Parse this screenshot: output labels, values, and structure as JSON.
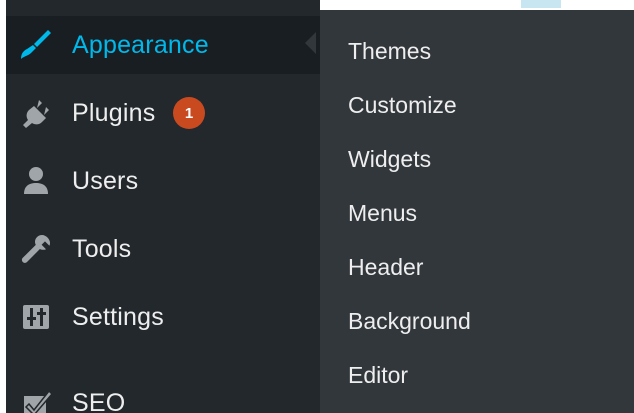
{
  "colors": {
    "menu_bg": "#23282d",
    "menu_current_bg": "#191e23",
    "submenu_bg": "#32373c",
    "text": "#eeeeee",
    "accent": "#00b9eb",
    "icon": "#a0a5aa",
    "badge": "#ca4a1f"
  },
  "menu": {
    "items": [
      {
        "label": "Appearance",
        "icon": "paintbrush-icon",
        "current": true
      },
      {
        "label": "Plugins",
        "icon": "plugin-plug-icon",
        "badge": "1"
      },
      {
        "label": "Users",
        "icon": "users-icon"
      },
      {
        "label": "Tools",
        "icon": "wrench-icon"
      },
      {
        "label": "Settings",
        "icon": "settings-sliders-icon"
      },
      {
        "label": "SEO",
        "icon": "seo-check-icon"
      }
    ]
  },
  "submenu": {
    "items": [
      {
        "label": "Themes"
      },
      {
        "label": "Customize"
      },
      {
        "label": "Widgets"
      },
      {
        "label": "Menus"
      },
      {
        "label": "Header"
      },
      {
        "label": "Background"
      },
      {
        "label": "Editor"
      }
    ]
  }
}
